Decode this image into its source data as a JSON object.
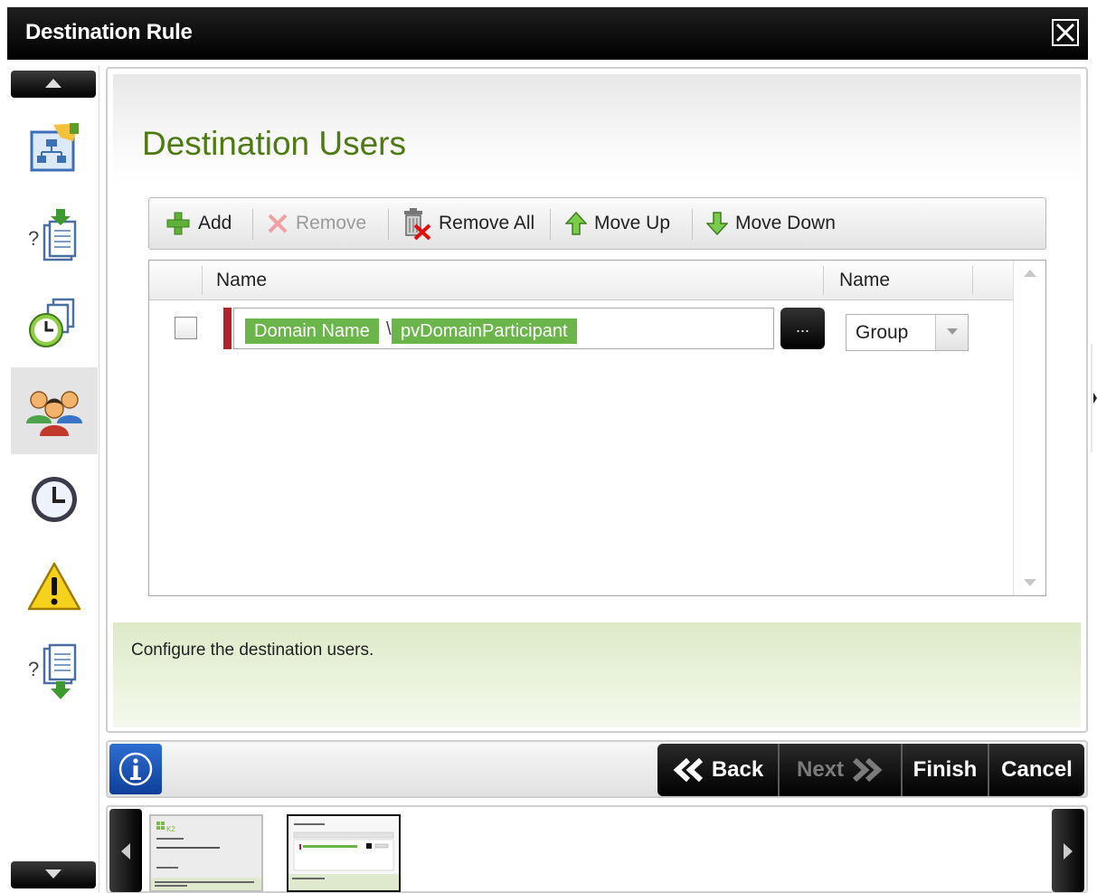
{
  "window": {
    "title": "Destination Rule"
  },
  "page": {
    "title": "Destination Users"
  },
  "toolbar": {
    "add_label": "Add",
    "remove_label": "Remove",
    "remove_all_label": "Remove All",
    "move_up_label": "Move Up",
    "move_down_label": "Move Down"
  },
  "grid": {
    "columns": [
      "Name",
      "Name"
    ],
    "rows": [
      {
        "checked": false,
        "name_tokens": [
          "Domain Name",
          "pvDomainParticipant"
        ],
        "separator_char": "\\",
        "browse_label": "...",
        "type": "Group"
      }
    ]
  },
  "help": {
    "text": "Configure the destination users."
  },
  "nav": {
    "back_label": "Back",
    "next_label": "Next",
    "finish_label": "Finish",
    "cancel_label": "Cancel"
  },
  "thumbnails": [
    {
      "label": "K2"
    },
    {
      "label": ""
    }
  ],
  "colors": {
    "title_green": "#4e7a12",
    "token_green": "#6ab64a",
    "required_red": "#b3212b",
    "help_bg": "#e6f0d4"
  },
  "icons": {
    "left_nav": [
      "process-chart-icon",
      "question-download-icon",
      "clock-pages-icon",
      "users-group-icon",
      "clock-icon",
      "warning-icon",
      "question-upload-icon"
    ]
  }
}
